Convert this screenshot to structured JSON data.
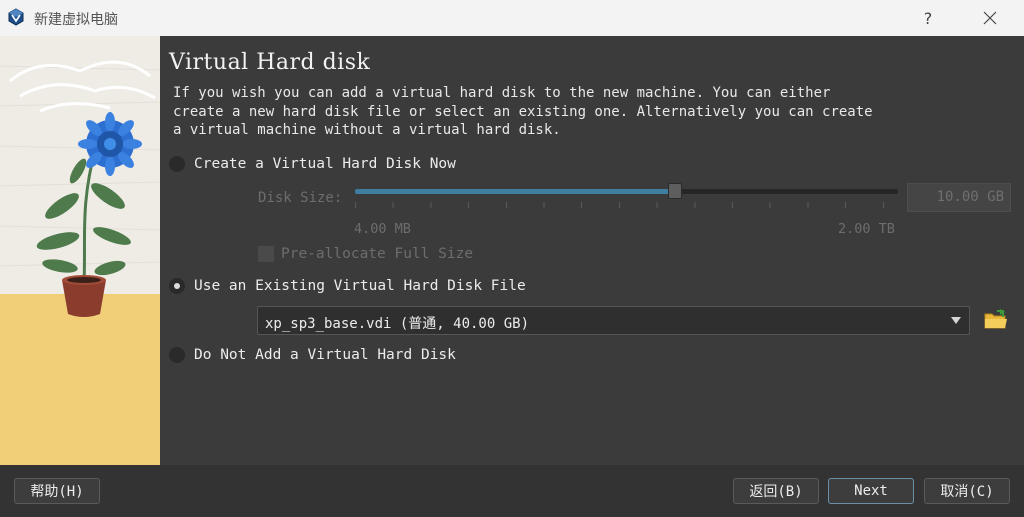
{
  "window": {
    "title": "新建虚拟电脑",
    "help_glyph": "?",
    "close_glyph": "✕"
  },
  "page": {
    "heading": "Virtual Hard disk",
    "description": "If you wish you can add a virtual hard disk to the new machine. You can either\ncreate a new hard disk file or select an existing one. Alternatively you can create\na virtual machine without a virtual hard disk."
  },
  "options": {
    "create_new": {
      "label": "Create a Virtual Hard Disk Now",
      "checked": false
    },
    "use_existing": {
      "label": "Use an Existing Virtual Hard Disk File",
      "checked": true
    },
    "do_not_add": {
      "label": "Do Not Add a Virtual Hard Disk",
      "checked": false
    }
  },
  "disk_size": {
    "label": "Disk Size:",
    "value": "10.00 GB",
    "min_label": "4.00 MB",
    "max_label": "2.00 TB",
    "slider_fraction": 0.59
  },
  "preallocate": {
    "label": "Pre-allocate Full Size",
    "checked": false
  },
  "existing_disk": {
    "selected": "xp_sp3_base.vdi (普通, 40.00 GB)"
  },
  "buttons": {
    "help": "帮助(H)",
    "back": "返回(B)",
    "next": "Next",
    "cancel": "取消(C)"
  },
  "colors": {
    "accent": "#3f7ea0",
    "background": "#3b3b3b",
    "titlebar": "#f3f3f3"
  }
}
